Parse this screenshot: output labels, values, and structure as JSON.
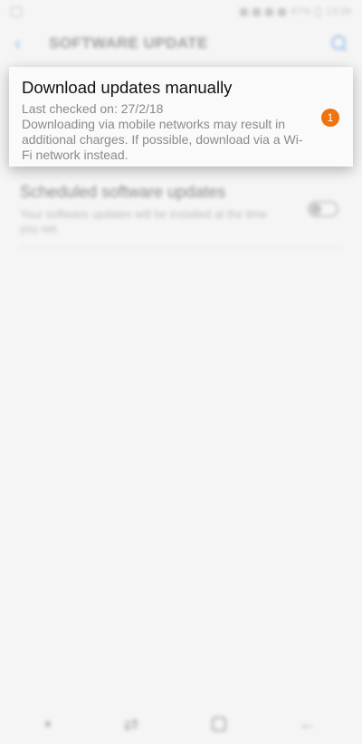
{
  "status_bar": {
    "battery": "67%",
    "time": "13:39"
  },
  "app_bar": {
    "title": "SOFTWARE UPDATE"
  },
  "highlight_card": {
    "title": "Download updates manually",
    "last_checked": "Last checked on: 27/2/18",
    "description": "Downloading via mobile networks may result in additional charges. If possible, download via a Wi-Fi network instead.",
    "badge_count": "1",
    "badge_color": "#f0730c"
  },
  "scheduled": {
    "title": "Scheduled software updates",
    "description": "Your software updates will be installed at the time you set.",
    "toggle_on": false
  },
  "accent_color": "#4a90d9"
}
